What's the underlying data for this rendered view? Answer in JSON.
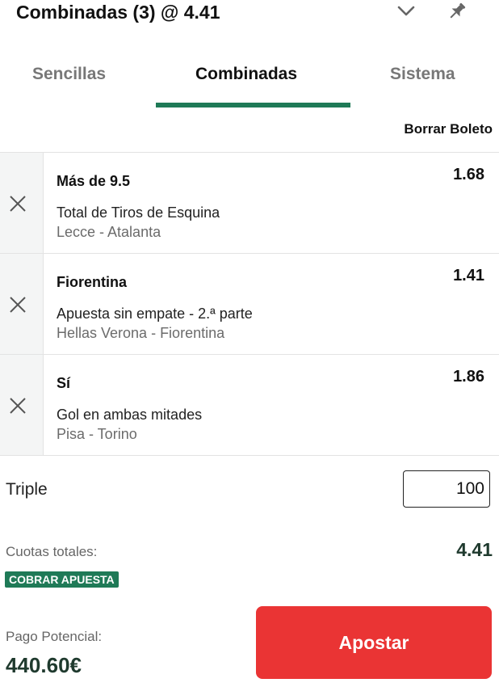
{
  "header": {
    "title": "Combinadas (3) @ 4.41",
    "collapse_icon": "chevron-down-icon",
    "pin_icon": "pin-icon"
  },
  "tabs": [
    {
      "label": "Sencillas",
      "active": false
    },
    {
      "label": "Combinadas",
      "active": true
    },
    {
      "label": "Sistema",
      "active": false
    }
  ],
  "clear_label": "Borrar Boleto",
  "selections": [
    {
      "selection": "Más de 9.5",
      "odds": "1.68",
      "market": "Total de Tiros de Esquina",
      "event": "Lecce - Atalanta"
    },
    {
      "selection": "Fiorentina",
      "odds": "1.41",
      "market": "Apuesta sin empate - 2.ª parte",
      "event": "Hellas Verona - Fiorentina"
    },
    {
      "selection": "Sí",
      "odds": "1.86",
      "market": "Gol en ambas mitades",
      "event": "Pisa - Torino"
    }
  ],
  "stake": {
    "label": "Triple",
    "value": "100"
  },
  "totals": {
    "odds_label": "Cuotas totales:",
    "odds_value": "4.41",
    "cashout_badge": "COBRAR APUESTA",
    "payout_label": "Pago Potencial:",
    "payout_value": "440.60€"
  },
  "place_bet_label": "Apostar",
  "colors": {
    "accent": "#1f7a57",
    "cta": "#ea3434"
  }
}
